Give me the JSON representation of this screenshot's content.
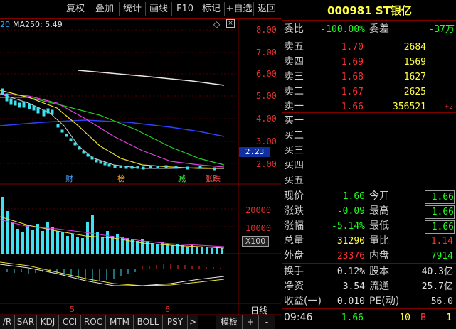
{
  "toolbar": {
    "buttons": [
      "复权",
      "叠加",
      "统计",
      "画线",
      "F10",
      "标记",
      "+自选",
      "返回"
    ]
  },
  "chart": {
    "ma_label": "MA250: 5.49",
    "ma_prefix": "20",
    "y_axis": [
      "8.00",
      "7.00",
      "6.00",
      "5.00",
      "4.00",
      "3.00",
      "2.00"
    ],
    "current_price_marker": "2.23",
    "event_tags": [
      "财",
      "榜",
      "减",
      "张跌"
    ],
    "volume_axis": [
      "20000",
      "10000"
    ],
    "volume_unit": "X100",
    "time_labels": [
      "5",
      "6"
    ],
    "period_label": "日线"
  },
  "bottom_tabs": [
    "/R",
    "SAR",
    "KDJ",
    "CCI",
    "ROC",
    "MTM",
    "BOLL",
    "PSY",
    ">"
  ],
  "bottom_extra": {
    "template": "模板",
    "plus": "+",
    "minus": "-"
  },
  "stock": {
    "code_name": "000981 ST银亿",
    "weibi_label": "委比",
    "weibi_value": "-100.00%",
    "weicha_label": "委差",
    "weicha_value": "-37万"
  },
  "sell_orders": [
    {
      "label": "卖五",
      "price": "1.70",
      "vol": "2684",
      "change": ""
    },
    {
      "label": "卖四",
      "price": "1.69",
      "vol": "1569",
      "change": ""
    },
    {
      "label": "卖三",
      "price": "1.68",
      "vol": "1627",
      "change": ""
    },
    {
      "label": "卖二",
      "price": "1.67",
      "vol": "2625",
      "change": ""
    },
    {
      "label": "卖一",
      "price": "1.66",
      "vol": "356521",
      "change": "+2"
    }
  ],
  "buy_orders": [
    {
      "label": "买一"
    },
    {
      "label": "买二"
    },
    {
      "label": "买三"
    },
    {
      "label": "买四"
    },
    {
      "label": "买五"
    }
  ],
  "quote": [
    {
      "l1": "现价",
      "v1": "1.66",
      "l2": "今开",
      "v2": "1.66"
    },
    {
      "l1": "涨跌",
      "v1": "-0.09",
      "l2": "最高",
      "v2": "1.66"
    },
    {
      "l1": "涨幅",
      "v1": "-5.14%",
      "l2": "最低",
      "v2": "1.66"
    },
    {
      "l1": "总量",
      "v1": "31290",
      "l2": "量比",
      "v2": "1.14"
    },
    {
      "l1": "外盘",
      "v1": "23376",
      "l2": "内盘",
      "v2": "7914"
    }
  ],
  "fundamentals": [
    {
      "l1": "换手",
      "v1": "0.12%",
      "l2": "股本",
      "v2": "40.3亿"
    },
    {
      "l1": "净资",
      "v1": "3.54",
      "l2": "流通",
      "v2": "25.7亿"
    },
    {
      "l1": "收益(一)",
      "v1": "0.010",
      "l2": "PE(动)",
      "v2": "56.0"
    }
  ],
  "tick": {
    "time": "09:46",
    "price": "1.66",
    "vol": "10",
    "side": "B",
    "count": "1"
  },
  "colors": {
    "up": "#ff3030",
    "down": "#20ff20",
    "accent": "#ffff40",
    "border": "#800000"
  }
}
